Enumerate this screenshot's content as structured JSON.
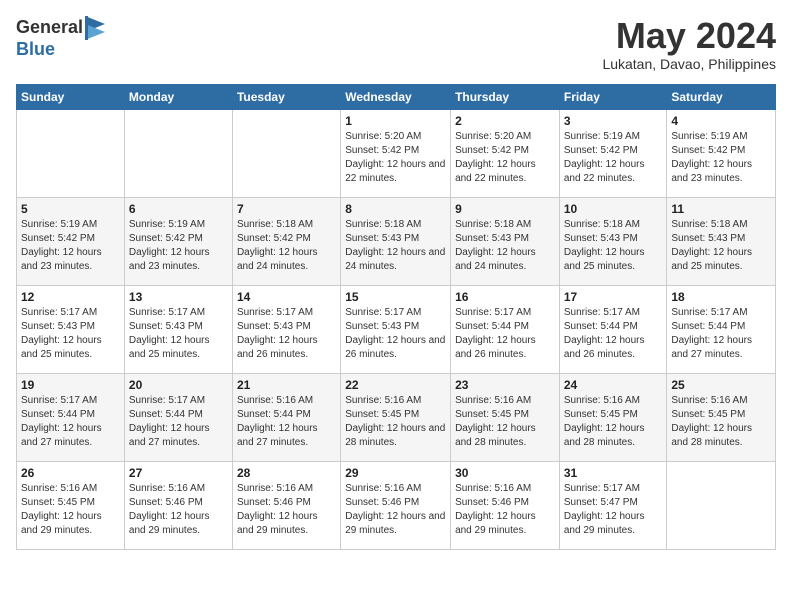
{
  "header": {
    "logo_general": "General",
    "logo_blue": "Blue",
    "month_year": "May 2024",
    "location": "Lukatan, Davao, Philippines"
  },
  "calendar": {
    "days_of_week": [
      "Sunday",
      "Monday",
      "Tuesday",
      "Wednesday",
      "Thursday",
      "Friday",
      "Saturday"
    ],
    "weeks": [
      [
        {
          "day": "",
          "info": ""
        },
        {
          "day": "",
          "info": ""
        },
        {
          "day": "",
          "info": ""
        },
        {
          "day": "1",
          "info": "Sunrise: 5:20 AM\nSunset: 5:42 PM\nDaylight: 12 hours and 22 minutes."
        },
        {
          "day": "2",
          "info": "Sunrise: 5:20 AM\nSunset: 5:42 PM\nDaylight: 12 hours and 22 minutes."
        },
        {
          "day": "3",
          "info": "Sunrise: 5:19 AM\nSunset: 5:42 PM\nDaylight: 12 hours and 22 minutes."
        },
        {
          "day": "4",
          "info": "Sunrise: 5:19 AM\nSunset: 5:42 PM\nDaylight: 12 hours and 23 minutes."
        }
      ],
      [
        {
          "day": "5",
          "info": "Sunrise: 5:19 AM\nSunset: 5:42 PM\nDaylight: 12 hours and 23 minutes."
        },
        {
          "day": "6",
          "info": "Sunrise: 5:19 AM\nSunset: 5:42 PM\nDaylight: 12 hours and 23 minutes."
        },
        {
          "day": "7",
          "info": "Sunrise: 5:18 AM\nSunset: 5:42 PM\nDaylight: 12 hours and 24 minutes."
        },
        {
          "day": "8",
          "info": "Sunrise: 5:18 AM\nSunset: 5:43 PM\nDaylight: 12 hours and 24 minutes."
        },
        {
          "day": "9",
          "info": "Sunrise: 5:18 AM\nSunset: 5:43 PM\nDaylight: 12 hours and 24 minutes."
        },
        {
          "day": "10",
          "info": "Sunrise: 5:18 AM\nSunset: 5:43 PM\nDaylight: 12 hours and 25 minutes."
        },
        {
          "day": "11",
          "info": "Sunrise: 5:18 AM\nSunset: 5:43 PM\nDaylight: 12 hours and 25 minutes."
        }
      ],
      [
        {
          "day": "12",
          "info": "Sunrise: 5:17 AM\nSunset: 5:43 PM\nDaylight: 12 hours and 25 minutes."
        },
        {
          "day": "13",
          "info": "Sunrise: 5:17 AM\nSunset: 5:43 PM\nDaylight: 12 hours and 25 minutes."
        },
        {
          "day": "14",
          "info": "Sunrise: 5:17 AM\nSunset: 5:43 PM\nDaylight: 12 hours and 26 minutes."
        },
        {
          "day": "15",
          "info": "Sunrise: 5:17 AM\nSunset: 5:43 PM\nDaylight: 12 hours and 26 minutes."
        },
        {
          "day": "16",
          "info": "Sunrise: 5:17 AM\nSunset: 5:44 PM\nDaylight: 12 hours and 26 minutes."
        },
        {
          "day": "17",
          "info": "Sunrise: 5:17 AM\nSunset: 5:44 PM\nDaylight: 12 hours and 26 minutes."
        },
        {
          "day": "18",
          "info": "Sunrise: 5:17 AM\nSunset: 5:44 PM\nDaylight: 12 hours and 27 minutes."
        }
      ],
      [
        {
          "day": "19",
          "info": "Sunrise: 5:17 AM\nSunset: 5:44 PM\nDaylight: 12 hours and 27 minutes."
        },
        {
          "day": "20",
          "info": "Sunrise: 5:17 AM\nSunset: 5:44 PM\nDaylight: 12 hours and 27 minutes."
        },
        {
          "day": "21",
          "info": "Sunrise: 5:16 AM\nSunset: 5:44 PM\nDaylight: 12 hours and 27 minutes."
        },
        {
          "day": "22",
          "info": "Sunrise: 5:16 AM\nSunset: 5:45 PM\nDaylight: 12 hours and 28 minutes."
        },
        {
          "day": "23",
          "info": "Sunrise: 5:16 AM\nSunset: 5:45 PM\nDaylight: 12 hours and 28 minutes."
        },
        {
          "day": "24",
          "info": "Sunrise: 5:16 AM\nSunset: 5:45 PM\nDaylight: 12 hours and 28 minutes."
        },
        {
          "day": "25",
          "info": "Sunrise: 5:16 AM\nSunset: 5:45 PM\nDaylight: 12 hours and 28 minutes."
        }
      ],
      [
        {
          "day": "26",
          "info": "Sunrise: 5:16 AM\nSunset: 5:45 PM\nDaylight: 12 hours and 29 minutes."
        },
        {
          "day": "27",
          "info": "Sunrise: 5:16 AM\nSunset: 5:46 PM\nDaylight: 12 hours and 29 minutes."
        },
        {
          "day": "28",
          "info": "Sunrise: 5:16 AM\nSunset: 5:46 PM\nDaylight: 12 hours and 29 minutes."
        },
        {
          "day": "29",
          "info": "Sunrise: 5:16 AM\nSunset: 5:46 PM\nDaylight: 12 hours and 29 minutes."
        },
        {
          "day": "30",
          "info": "Sunrise: 5:16 AM\nSunset: 5:46 PM\nDaylight: 12 hours and 29 minutes."
        },
        {
          "day": "31",
          "info": "Sunrise: 5:17 AM\nSunset: 5:47 PM\nDaylight: 12 hours and 29 minutes."
        },
        {
          "day": "",
          "info": ""
        }
      ]
    ]
  }
}
